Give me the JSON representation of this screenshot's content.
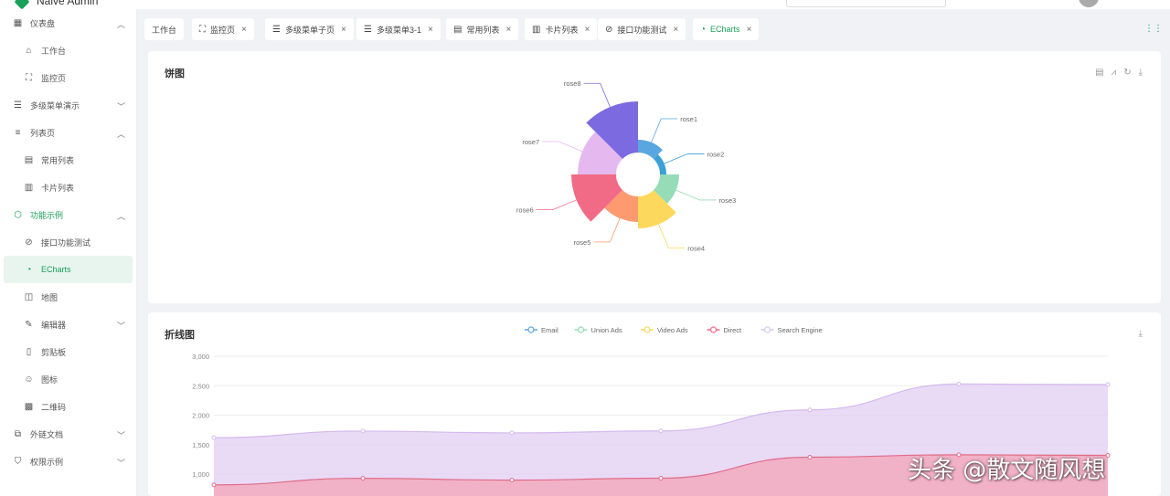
{
  "header": {
    "app_title": "Naive Admin"
  },
  "sidebar": {
    "items": [
      {
        "label": "仪表盘",
        "icon": "dashboard-icon",
        "level": 1,
        "chevron": "up"
      },
      {
        "label": "工作台",
        "icon": "workbench-icon",
        "level": 2
      },
      {
        "label": "监控页",
        "icon": "monitor-icon",
        "level": 2
      },
      {
        "label": "多级菜单演示",
        "icon": "list-tree-icon",
        "level": 1,
        "chevron": "down"
      },
      {
        "label": "列表页",
        "icon": "list-icon",
        "level": 1,
        "chevron": "up"
      },
      {
        "label": "常用列表",
        "icon": "table-icon",
        "level": 2
      },
      {
        "label": "卡片列表",
        "icon": "card-list-icon",
        "level": 2
      },
      {
        "label": "功能示例",
        "icon": "cube-icon",
        "level": 1,
        "chevron": "up",
        "active": true
      },
      {
        "label": "接口功能测试",
        "icon": "api-icon",
        "level": 2
      },
      {
        "label": "ECharts",
        "icon": "pie-chart-icon",
        "level": 2,
        "selected": true
      },
      {
        "label": "地图",
        "icon": "map-icon",
        "level": 2
      },
      {
        "label": "编辑器",
        "icon": "editor-icon",
        "level": 2,
        "chevron": "down"
      },
      {
        "label": "剪贴板",
        "icon": "clipboard-icon",
        "level": 2
      },
      {
        "label": "图标",
        "icon": "smile-icon",
        "level": 2
      },
      {
        "label": "二维码",
        "icon": "qrcode-icon",
        "level": 2
      },
      {
        "label": "外链文档",
        "icon": "link-doc-icon",
        "level": 1,
        "chevron": "down"
      },
      {
        "label": "权限示例",
        "icon": "shield-icon",
        "level": 1,
        "chevron": "down"
      }
    ]
  },
  "tabs": [
    {
      "label": "工作台",
      "icon": "",
      "closable": false
    },
    {
      "label": "监控页",
      "icon": "monitor-icon",
      "closable": true
    },
    {
      "label": "多级菜单子页",
      "icon": "list-tree-icon",
      "closable": true
    },
    {
      "label": "多级菜单3-1",
      "icon": "list-tree-icon",
      "closable": true
    },
    {
      "label": "常用列表",
      "icon": "table-icon",
      "closable": true
    },
    {
      "label": "卡片列表",
      "icon": "card-list-icon",
      "closable": true
    },
    {
      "label": "接口功能测试",
      "icon": "api-icon",
      "closable": true
    },
    {
      "label": "ECharts",
      "icon": "pie-chart-icon",
      "closable": true,
      "active": true
    }
  ],
  "pie_card": {
    "title": "饼图",
    "tools": [
      "data-view-icon",
      "line-switch-icon",
      "restore-icon",
      "download-icon"
    ]
  },
  "line_card": {
    "title": "折线图",
    "tools": [
      "download-icon"
    ]
  },
  "watermark": "头条 @散文随风想",
  "colors": {
    "accent": "#18a058"
  },
  "chart_data": [
    {
      "type": "pie",
      "subtype": "nightingale-rose",
      "title": "饼图",
      "slices": [
        {
          "name": "rose1",
          "value": 10,
          "color": "#5aa6e0"
        },
        {
          "name": "rose2",
          "value": 5,
          "color": "#3ba0d6"
        },
        {
          "name": "rose3",
          "value": 15,
          "color": "#95dcb7"
        },
        {
          "name": "rose4",
          "value": 25,
          "color": "#fcd85c"
        },
        {
          "name": "rose5",
          "value": 20,
          "color": "#fd9a70"
        },
        {
          "name": "rose6",
          "value": 35,
          "color": "#f26b86"
        },
        {
          "name": "rose7",
          "value": 30,
          "color": "#e5b8ef"
        },
        {
          "name": "rose8",
          "value": 40,
          "color": "#7b6ae0"
        }
      ]
    },
    {
      "type": "area",
      "stacked": true,
      "title": "折线图",
      "legend": [
        "Email",
        "Union Ads",
        "Video Ads",
        "Direct",
        "Search Engine"
      ],
      "legend_colors": [
        "#5aa6e0",
        "#95dcb7",
        "#fcd85c",
        "#f26b86",
        "#d8c8ec"
      ],
      "yticks": [
        "3,000",
        "2,500",
        "2,000",
        "1,500",
        "1,000"
      ],
      "ylim": [
        0,
        3000
      ],
      "series": [
        {
          "name": "Direct",
          "color": "#f3a3b6",
          "stroke": "#e06c8a",
          "values": [
            820,
            932,
            901,
            934,
            1290,
            1330,
            1320
          ]
        },
        {
          "name": "Search Engine",
          "color": "#e2cdf3",
          "stroke": "#d5b9ee",
          "values": [
            1620,
            1732,
            1701,
            1734,
            2090,
            2530,
            2520
          ]
        }
      ]
    }
  ]
}
